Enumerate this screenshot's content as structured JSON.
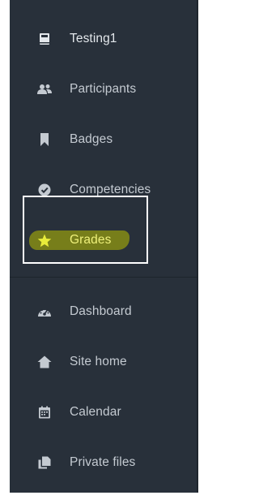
{
  "nav": {
    "course": {
      "label": "Testing1",
      "icon": "course-book-icon"
    },
    "items": [
      {
        "label": "Participants",
        "icon": "users-icon"
      },
      {
        "label": "Badges",
        "icon": "bookmark-icon"
      },
      {
        "label": "Competencies",
        "icon": "check-circle-icon"
      },
      {
        "label": "Grades",
        "icon": "star-icon"
      }
    ],
    "site": [
      {
        "label": "Dashboard",
        "icon": "dashboard-gauge-icon"
      },
      {
        "label": "Site home",
        "icon": "home-icon"
      },
      {
        "label": "Calendar",
        "icon": "calendar-icon"
      },
      {
        "label": "Private files",
        "icon": "files-icon"
      }
    ]
  },
  "colors": {
    "sidebar_bg": "#28303a",
    "text": "#c4cad1",
    "highlight": "#b8c000",
    "annotation_border": "#ffffff"
  }
}
